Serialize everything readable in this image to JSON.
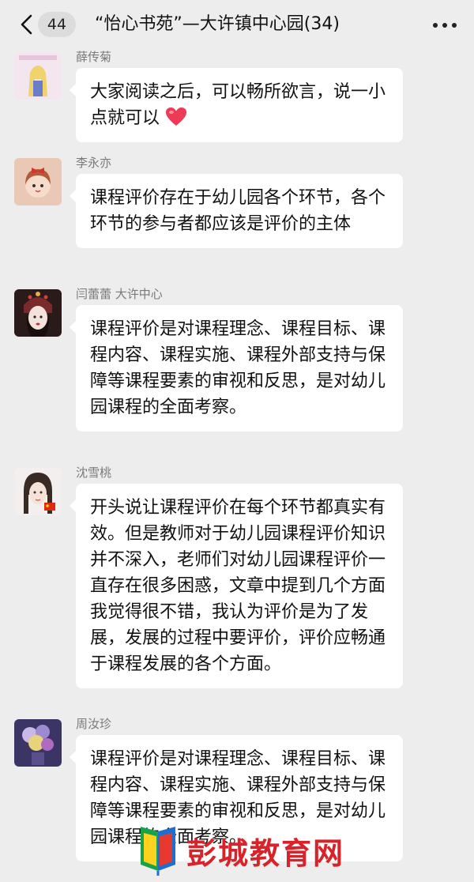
{
  "header": {
    "back_badge": "44",
    "title": "“怡心书苑”—大许镇中心园(34)"
  },
  "messages": [
    {
      "sender": "薛传菊",
      "text": "大家阅读之后，可以畅所欲言，说一小点就可以",
      "emoji": "heart-emoji"
    },
    {
      "sender": "李永亦",
      "text": "课程评价存在于幼儿园各个环节，各个环节的参与者都应该是评价的主体"
    },
    {
      "sender": "闫蕾蕾 大许中心",
      "text": "课程评价是对课程理念、课程目标、课程内容、课程实施、课程外部支持与保障等课程要素的审视和反思，是对幼儿园课程的全面考察。"
    },
    {
      "sender": "沈雪桃",
      "text": "开头说让课程评价在每个环节都真实有效。但是教师对于幼儿园课程评价知识并不深入，老师们对幼儿园课程评价一直存在很多困惑，文章中提到几个方面我觉得很不错，我认为评价是为了发展，发展的过程中要评价，评价应畅通于课程发展的各个方面。"
    },
    {
      "sender": "周汝珍",
      "text": "课程评价是对课程理念、课程目标、课程内容、课程实施、课程外部支持与保障等课程要素的审视和反思，是对幼儿园课程的全面考察。"
    }
  ],
  "watermark": {
    "text": "彭城教育网"
  },
  "colors": {
    "background": "#ededed",
    "bubble": "#ffffff",
    "sender": "#7a7a7a",
    "watermark": "#d8232a"
  }
}
